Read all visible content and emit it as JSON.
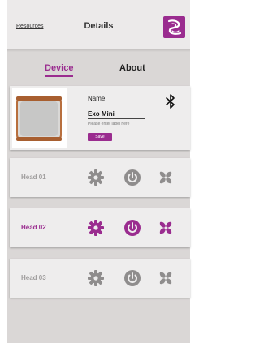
{
  "header": {
    "resources_label": "Resources",
    "title": "Details"
  },
  "tabs": [
    {
      "label": "Device",
      "active": true
    },
    {
      "label": "About",
      "active": false
    }
  ],
  "device": {
    "name_label": "Name:",
    "name_value": "Exo Mini",
    "name_hint": "Please enter label here",
    "save_label": "Save"
  },
  "heads": [
    {
      "label": "Head 01",
      "active": false
    },
    {
      "label": "Head 02",
      "active": true
    },
    {
      "label": "Head 03",
      "active": false
    }
  ],
  "colors": {
    "accent": "#9a2c8f",
    "inactive_icon": "#8f8d8d",
    "background": "#dad7d6",
    "card": "#eeeded"
  },
  "icons": [
    "app-logo-icon",
    "bluetooth-icon",
    "gear-icon",
    "power-icon",
    "fan-icon"
  ]
}
